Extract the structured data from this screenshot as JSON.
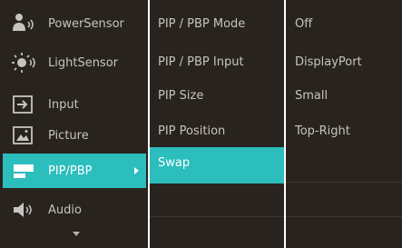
{
  "main_menu": {
    "items": [
      {
        "label": "PowerSensor",
        "icon": "power-sensor-icon"
      },
      {
        "label": "LightSensor",
        "icon": "light-sensor-icon"
      },
      {
        "label": "Input",
        "icon": "input-icon"
      },
      {
        "label": "Picture",
        "icon": "picture-icon"
      },
      {
        "label": "PIP/PBP",
        "icon": "pip-pbp-icon",
        "selected": true
      },
      {
        "label": "Audio",
        "icon": "audio-icon"
      }
    ]
  },
  "sub_menu": {
    "items": [
      {
        "label": "PIP / PBP Mode"
      },
      {
        "label": "PIP / PBP Input"
      },
      {
        "label": "PIP Size"
      },
      {
        "label": "PIP Position"
      },
      {
        "label": "Swap",
        "selected": true
      }
    ]
  },
  "values": {
    "items": [
      {
        "label": "Off"
      },
      {
        "label": "DisplayPort"
      },
      {
        "label": "Small"
      },
      {
        "label": "Top-Right"
      }
    ]
  },
  "colors": {
    "panel": "#29231f",
    "accent": "#2cbdbd",
    "text": "#c7c3be"
  }
}
